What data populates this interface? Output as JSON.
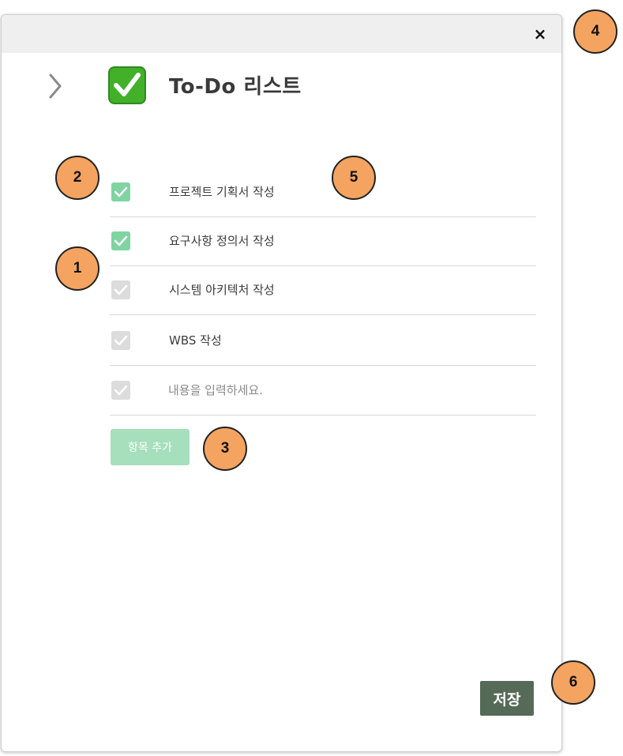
{
  "dialog": {
    "title": "To-Do 리스트",
    "close_glyph": "×"
  },
  "todos": [
    {
      "label": "프로젝트 기획서 작성",
      "checked": true
    },
    {
      "label": "요구사항 정의서 작성",
      "checked": true
    },
    {
      "label": "시스템 아키텍처 작성",
      "checked": false
    },
    {
      "label": "WBS 작성",
      "checked": false
    }
  ],
  "new_item": {
    "placeholder": "내용을 입력하세요.",
    "value": ""
  },
  "buttons": {
    "add_label": "항목 추가",
    "save_label": "저장"
  },
  "markers": [
    "1",
    "2",
    "3",
    "4",
    "5",
    "6"
  ],
  "colors": {
    "checked": "#7fd4a2",
    "unchecked": "#dcdcdc",
    "add_button": "#a5dfbb",
    "save_button": "#566a58",
    "marker": "#f4a460",
    "title_check": "#43b02a"
  },
  "icons": {
    "collapse": "chevron-right-icon",
    "title": "check-box-icon",
    "close": "close-icon",
    "item": "checkmark-icon"
  }
}
